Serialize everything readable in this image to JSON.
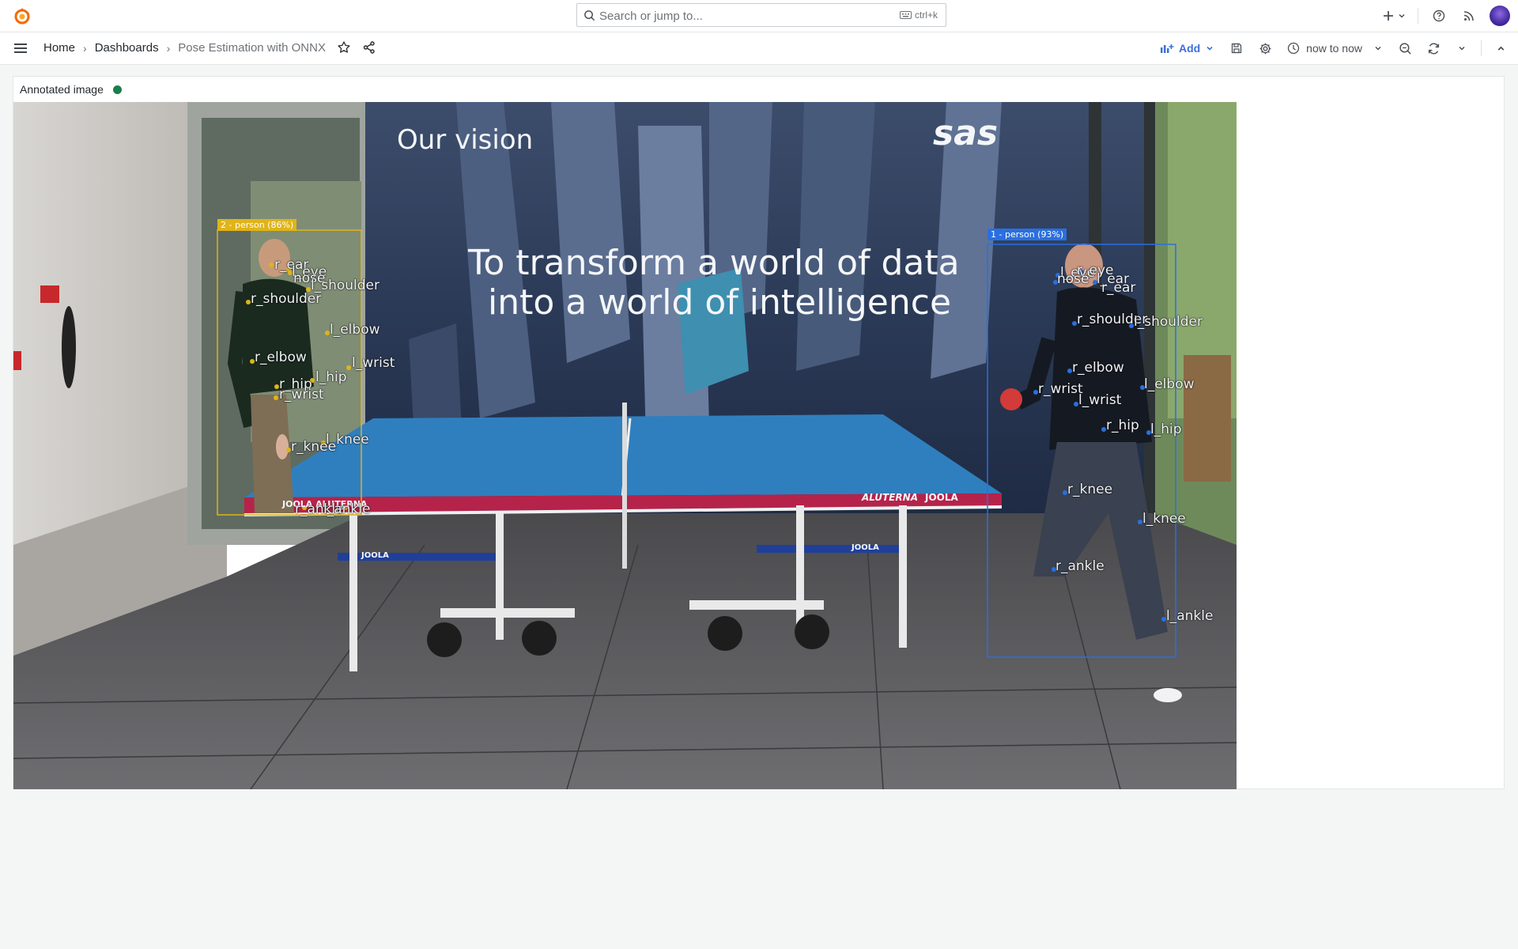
{
  "topbar": {
    "search_placeholder": "Search or jump to...",
    "search_shortcut": "ctrl+k",
    "icons": [
      "grafana-logo-icon",
      "search-icon",
      "keyboard-icon",
      "plus-icon",
      "chevron-down-icon",
      "help-icon",
      "rss-icon",
      "avatar"
    ]
  },
  "navbar": {
    "breadcrumbs": [
      "Home",
      "Dashboards",
      "Pose Estimation with ONNX"
    ],
    "add_label": "Add",
    "time_range": "now to now"
  },
  "panel": {
    "title": "Annotated image",
    "status_color": "#1a7f4b",
    "image": {
      "wall_text": {
        "heading": "Our vision",
        "tagline_line1": "To transform a world of data",
        "tagline_line2": "into a world of intelligence",
        "brand": "sas"
      },
      "table_branding": [
        "ALUTERNA",
        "JOOLA",
        "JOOLA",
        "JOOLA",
        "JOOLA ALUTERNA"
      ],
      "detections": [
        {
          "label": "2 - person (86%)",
          "color": "#e0b419",
          "keypoints": [
            "r_ear",
            "l_eye",
            "nose",
            "l_shoulder",
            "r_shoulder",
            "l_elbow",
            "r_elbow",
            "l_wrist",
            "l_hip",
            "r_hip",
            "r_wrist",
            "l_knee",
            "r_knee",
            "r_ankle",
            "l_ankle"
          ]
        },
        {
          "label": "1 - person (93%)",
          "color": "#2a6fe0",
          "keypoints": [
            "l_eye",
            "r_eye",
            "nose",
            "l_ear",
            "r_ear",
            "r_shoulder",
            "l_shoulder",
            "r_elbow",
            "l_elbow",
            "r_wrist",
            "l_wrist",
            "r_hip",
            "l_hip",
            "r_knee",
            "l_knee",
            "r_ankle",
            "l_ankle"
          ]
        }
      ]
    }
  }
}
